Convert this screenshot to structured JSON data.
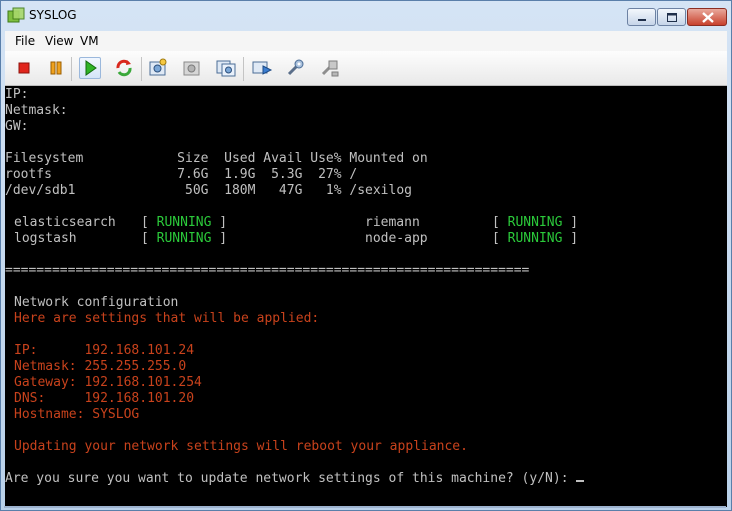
{
  "window": {
    "title": "SYSLOG"
  },
  "menu": {
    "items": [
      "File",
      "View",
      "VM"
    ]
  },
  "toolbar": {
    "buttons": [
      {
        "name": "stop-icon"
      },
      {
        "name": "pause-icon"
      },
      {
        "name": "play-icon"
      },
      {
        "name": "reset-icon"
      },
      {
        "name": "snapshot-icon"
      },
      {
        "name": "revert-icon"
      },
      {
        "name": "manage-snapshots-icon"
      },
      {
        "name": "send-ctrl-alt-del-icon"
      },
      {
        "name": "settings-icon"
      },
      {
        "name": "install-tools-icon"
      }
    ]
  },
  "console": {
    "ip_label": "IP:",
    "netmask_label": "Netmask:",
    "gw_label": "GW:",
    "df_header": "Filesystem            Size  Used Avail Use% Mounted on",
    "df_rows": [
      "rootfs                7.6G  1.9G  5.3G  27% /",
      "/dev/sdb1              50G  180M   47G   1% /sexilog"
    ],
    "services": [
      {
        "name": "elasticsearch",
        "status": "RUNNING"
      },
      {
        "name": "riemann",
        "status": "RUNNING"
      },
      {
        "name": "logstash",
        "status": "RUNNING"
      },
      {
        "name": "node-app",
        "status": "RUNNING"
      }
    ],
    "separator": "===================================================================",
    "net_title": "Network configuration",
    "net_subtitle": "Here are settings that will be applied:",
    "settings": [
      {
        "label": "IP:      ",
        "value": "192.168.101.24"
      },
      {
        "label": "Netmask: ",
        "value": "255.255.255.0"
      },
      {
        "label": "Gateway: ",
        "value": "192.168.101.254"
      },
      {
        "label": "DNS:     ",
        "value": "192.168.101.20"
      },
      {
        "label": "Hostname: ",
        "value": "SYSLOG"
      }
    ],
    "warning": "Updating your network settings will reboot your appliance.",
    "prompt": "Are you sure you want to update network settings of this machine? (y/N): "
  }
}
